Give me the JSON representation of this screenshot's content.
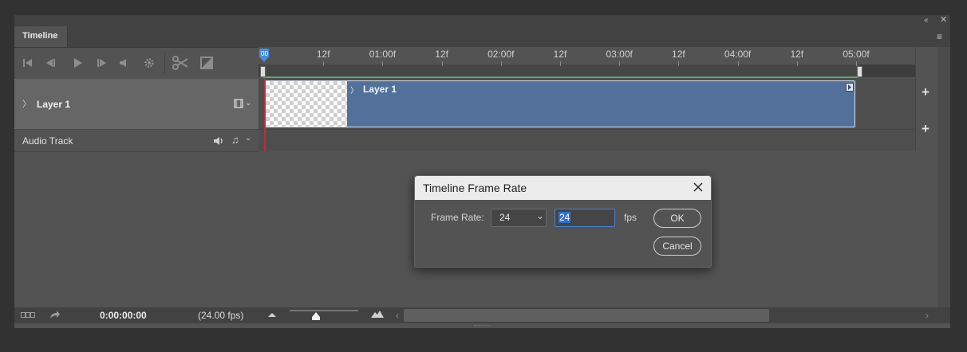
{
  "panel": {
    "tab_label": "Timeline",
    "controls": {
      "first_frame_icon": "skip-to-first-icon",
      "prev_frame_icon": "step-back-icon",
      "play_icon": "play-icon",
      "next_frame_icon": "step-forward-icon",
      "audio_icon": "speaker-icon",
      "settings_icon": "gear-icon",
      "split_icon": "scissors-icon",
      "transition_icon": "transition-icon"
    },
    "ruler": {
      "playhead_label": "00",
      "ticks": [
        {
          "label": "12f"
        },
        {
          "label": "01:00f"
        },
        {
          "label": "12f"
        },
        {
          "label": "02:00f"
        },
        {
          "label": "12f"
        },
        {
          "label": "03:00f"
        },
        {
          "label": "12f"
        },
        {
          "label": "04:00f"
        },
        {
          "label": "12f"
        },
        {
          "label": "05:00f"
        }
      ]
    },
    "layer_track": {
      "name": "Layer 1",
      "clip_name": "Layer 1"
    },
    "audio_track": {
      "name": "Audio Track"
    },
    "bottom": {
      "timecode": "0:00:00:00",
      "fps": "(24.00 fps)"
    }
  },
  "dialog": {
    "title": "Timeline Frame Rate",
    "frame_rate_label": "Frame Rate:",
    "frame_rate_selected": "24",
    "custom_value": "24",
    "fps_unit": "fps",
    "ok_label": "OK",
    "cancel_label": "Cancel"
  },
  "colors": {
    "clip": "#52709a",
    "playhead": "#4a8fe0",
    "work_area_line": "#59a86b",
    "current_time_line": "#b9303a"
  }
}
